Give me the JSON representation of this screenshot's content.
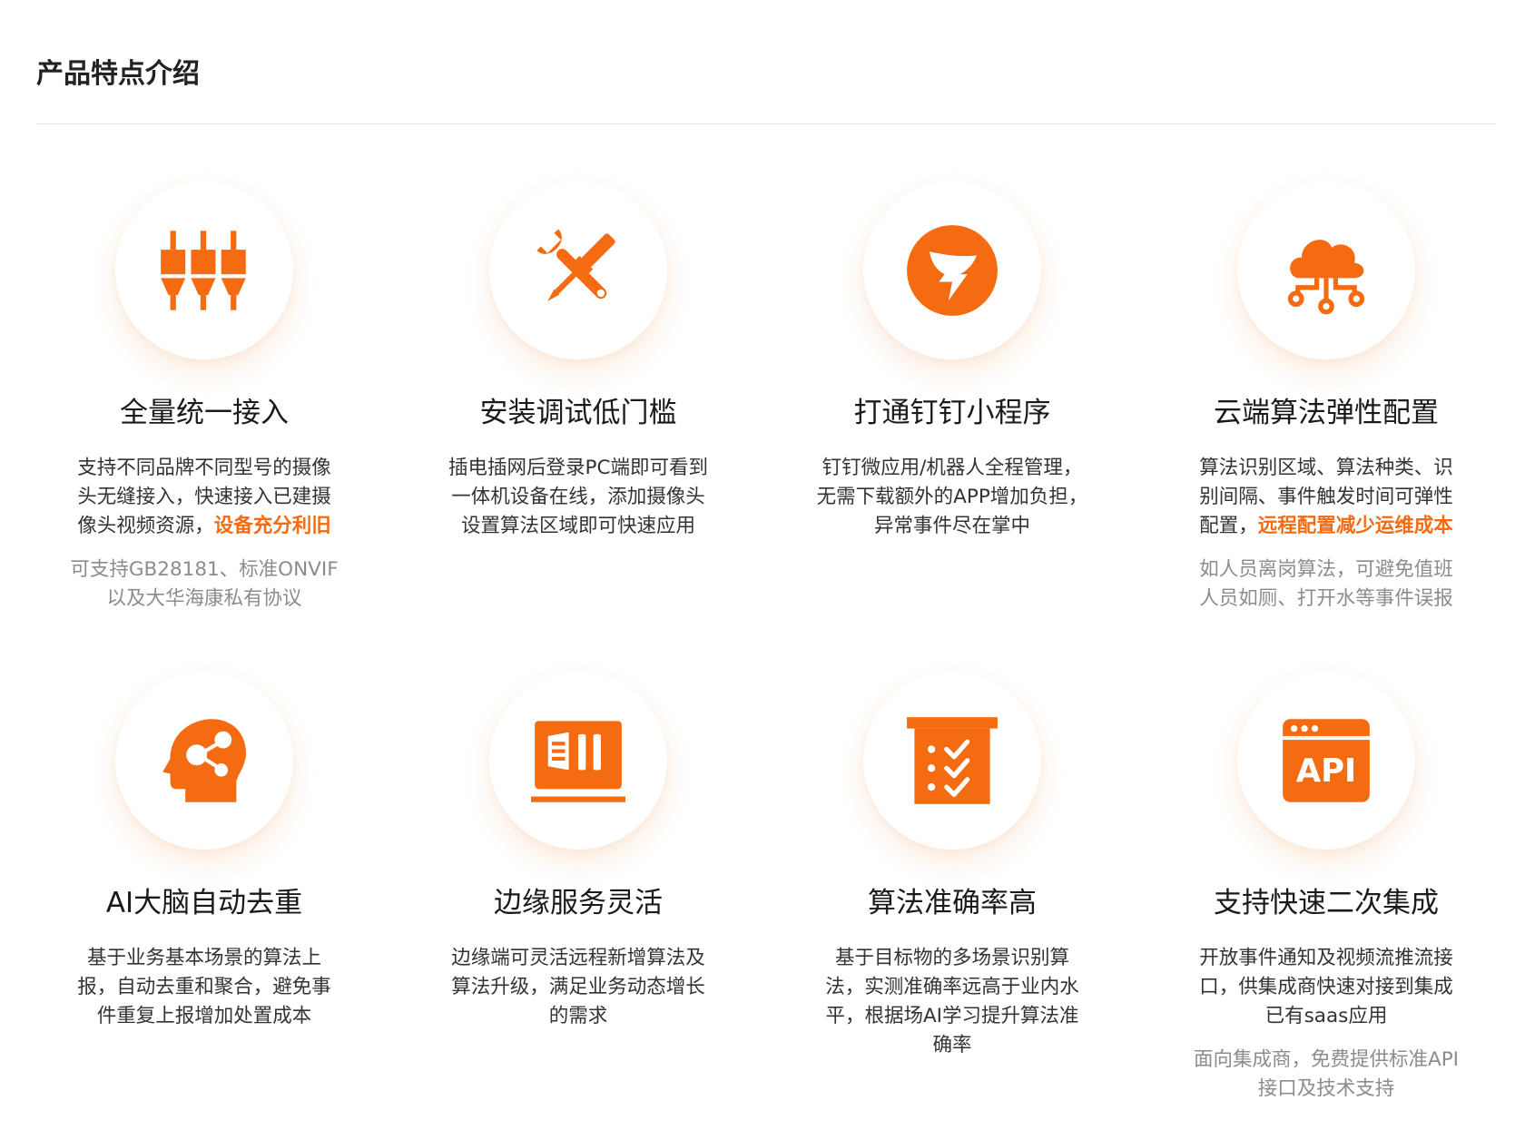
{
  "header": {
    "title": "产品特点介绍"
  },
  "colors": {
    "accent": "#f46b12",
    "text": "#1a1a1a",
    "muted": "#8c8c8c"
  },
  "cards": [
    {
      "icon": "connector-plugs-icon",
      "title": "全量统一接入",
      "desc": "支持不同品牌不同型号的摄像头无缝接入，快速接入已建摄像头视频资源，",
      "highlight": "设备充分利旧",
      "desc_tail": "",
      "note": "可支持GB28181、标准ONVIF以及大华海康私有协议"
    },
    {
      "icon": "wrench-screwdriver-icon",
      "title": "安装调试低门槛",
      "desc": "插电插网后登录PC端即可看到一体机设备在线，添加摄像头设置算法区域即可快速应用",
      "highlight": "",
      "desc_tail": "",
      "note": ""
    },
    {
      "icon": "dingtalk-logo-icon",
      "title": "打通钉钉小程序",
      "desc": "钉钉微应用/机器人全程管理，无需下载额外的APP增加负担，异常事件尽在掌中",
      "highlight": "",
      "desc_tail": "",
      "note": ""
    },
    {
      "icon": "cloud-network-icon",
      "title": "云端算法弹性配置",
      "desc": "算法识别区域、算法种类、识别间隔、事件触发时间可弹性配置，",
      "highlight": "远程配置减少运维成本",
      "desc_tail": "",
      "note": "如人员离岗算法，可避免值班人员如厕、打开水等事件误报"
    },
    {
      "icon": "ai-brain-head-icon",
      "title": "AI大脑自动去重",
      "desc": "基于业务基本场景的算法上报，自动去重和聚合，避免事件重复上报增加处置成本",
      "highlight": "",
      "desc_tail": "",
      "note": ""
    },
    {
      "icon": "edge-server-icon",
      "title": "边缘服务灵活",
      "desc": "边缘端可灵活远程新增算法及算法升级，满足业务动态增长的需求",
      "highlight": "",
      "desc_tail": "",
      "note": ""
    },
    {
      "icon": "checklist-clipboard-icon",
      "title": "算法准确率高",
      "desc": "基于目标物的多场景识别算法，实测准确率远高于业内水平，根据场AI学习提升算法准确率",
      "highlight": "",
      "desc_tail": "",
      "note": ""
    },
    {
      "icon": "api-window-icon",
      "title": "支持快速二次集成",
      "desc": "开放事件通知及视频流推流接口，供集成商快速对接到集成已有saas应用",
      "highlight": "",
      "desc_tail": "",
      "note": "面向集成商，免费提供标准API接口及技术支持"
    }
  ],
  "api_icon_label": "API"
}
